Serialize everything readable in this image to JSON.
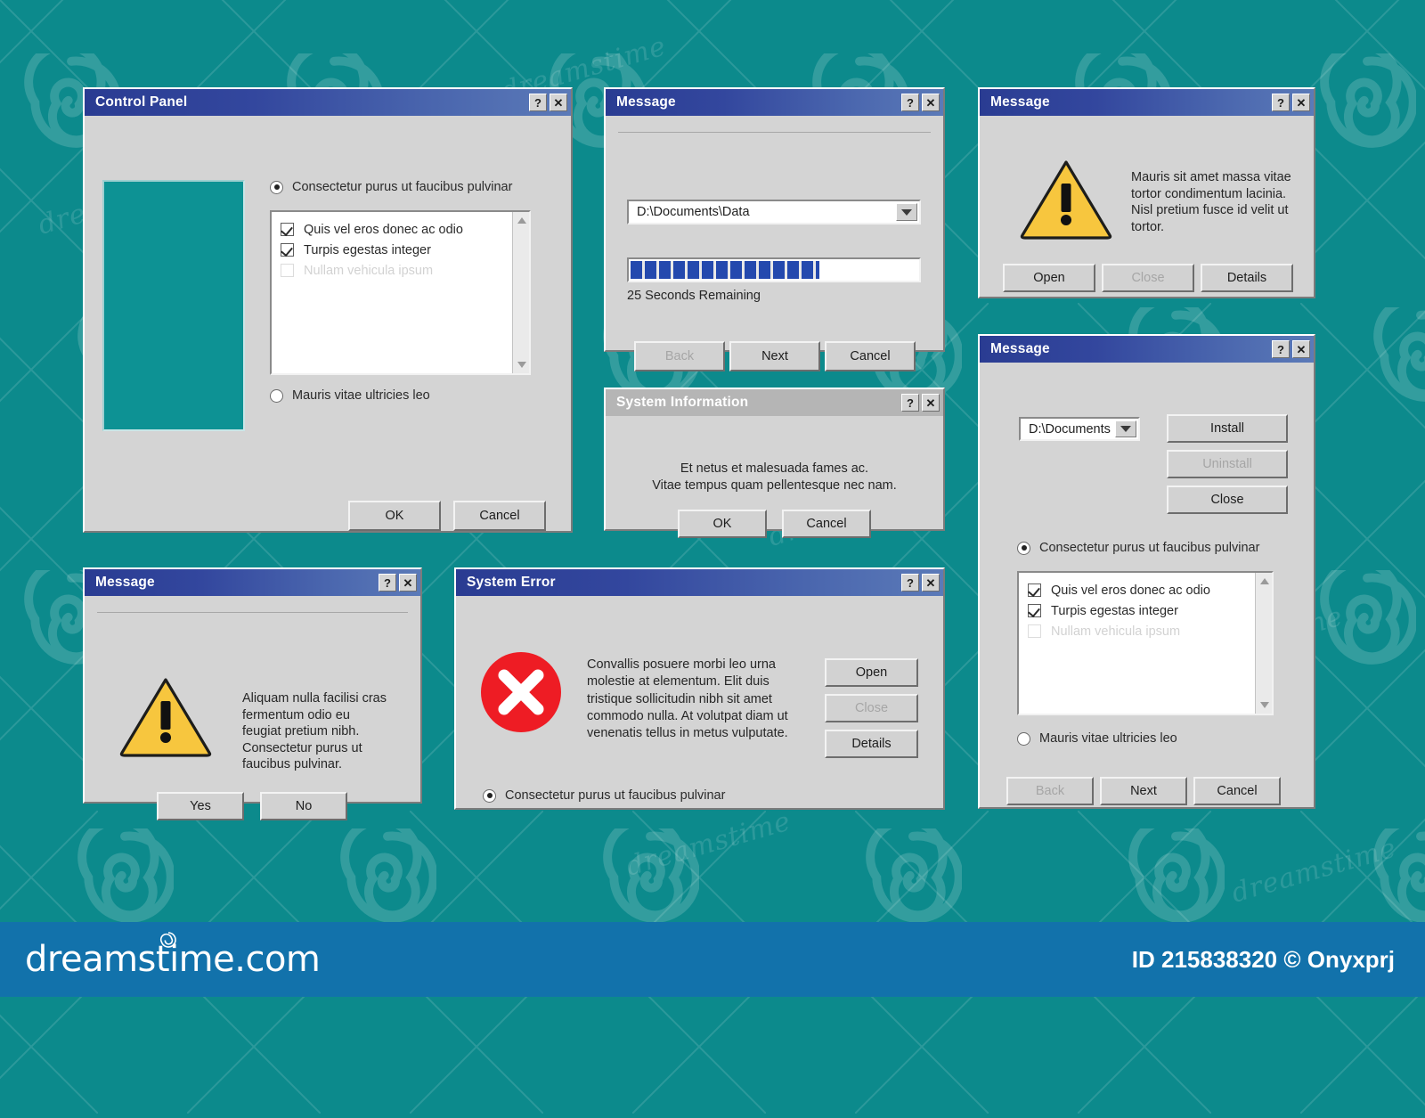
{
  "theme": {
    "desktop_bg": "#0c8a8c",
    "window_face": "#d4d4d4",
    "titlebar_active_from": "#2a3c92",
    "titlebar_active_to": "#5b7ab8",
    "titlebar_inactive": "#b5b5b5",
    "progress_fill": "#2449ae",
    "warning_yellow": "#f7c63e",
    "error_red": "#ee1c24",
    "footer_blue": "#1272ab"
  },
  "titlebar_buttons": {
    "help": "?",
    "close": "✕"
  },
  "windows": {
    "control_panel": {
      "title": "Control Panel",
      "radio_top": {
        "label": "Consectetur purus ut faucibus pulvinar",
        "selected": true
      },
      "radio_bottom": {
        "label": "Mauris vitae ultricies leo",
        "selected": false
      },
      "list_items": [
        {
          "label": "Quis vel eros donec ac odio",
          "checked": true,
          "disabled": false
        },
        {
          "label": "Turpis egestas integer",
          "checked": true,
          "disabled": false
        },
        {
          "label": "Nullam vehicula ipsum",
          "checked": false,
          "disabled": true
        }
      ],
      "buttons": {
        "ok": "OK",
        "cancel": "Cancel"
      }
    },
    "progress_message": {
      "title": "Message",
      "path_value": "D:\\Documents\\Data",
      "progress_percent": 65,
      "status": "25 Seconds Remaining",
      "buttons": {
        "back": "Back",
        "next": "Next",
        "cancel": "Cancel"
      }
    },
    "system_information": {
      "title": "System Information",
      "text_line1": "Et netus et malesuada fames ac.",
      "text_line2": "Vitae tempus quam pellentesque nec nam.",
      "buttons": {
        "ok": "OK",
        "cancel": "Cancel"
      }
    },
    "warning_message_right": {
      "title": "Message",
      "icon": "warning-triangle-icon",
      "text": "Mauris sit amet massa vitae tortor condimentum lacinia. Nisl pretium fusce id velit ut tortor.",
      "buttons": {
        "open": "Open",
        "close": "Close",
        "details": "Details"
      }
    },
    "installer_message": {
      "title": "Message",
      "path_value": "D:\\Documents",
      "buttons": {
        "install": "Install",
        "uninstall": "Uninstall",
        "close": "Close",
        "back": "Back",
        "next": "Next",
        "cancel": "Cancel"
      },
      "radio_top": {
        "label": "Consectetur purus ut faucibus pulvinar",
        "selected": true
      },
      "radio_bottom": {
        "label": "Mauris vitae ultricies leo",
        "selected": false
      },
      "list_items": [
        {
          "label": "Quis vel eros donec ac odio",
          "checked": true,
          "disabled": false
        },
        {
          "label": "Turpis egestas integer",
          "checked": true,
          "disabled": false
        },
        {
          "label": "Nullam vehicula ipsum",
          "checked": false,
          "disabled": true
        }
      ]
    },
    "warning_message_left": {
      "title": "Message",
      "icon": "warning-triangle-icon",
      "text": "Aliquam nulla facilisi cras fermentum odio eu feugiat pretium nibh. Consectetur purus ut faucibus pulvinar.",
      "buttons": {
        "yes": "Yes",
        "no": "No"
      }
    },
    "system_error": {
      "title": "System Error",
      "icon": "error-cross-icon",
      "text": "Convallis posuere morbi leo urna molestie at elementum. Elit duis tristique sollicitudin nibh sit amet commodo nulla. At volutpat diam ut venenatis tellus in metus vulputate.",
      "buttons": {
        "open": "Open",
        "close": "Close",
        "details": "Details"
      },
      "radio": {
        "label": "Consectetur purus ut faucibus pulvinar",
        "selected": true
      }
    }
  },
  "footer": {
    "brand": "dreamstime.com",
    "credit": "ID 215838320 © Onyxprj"
  }
}
